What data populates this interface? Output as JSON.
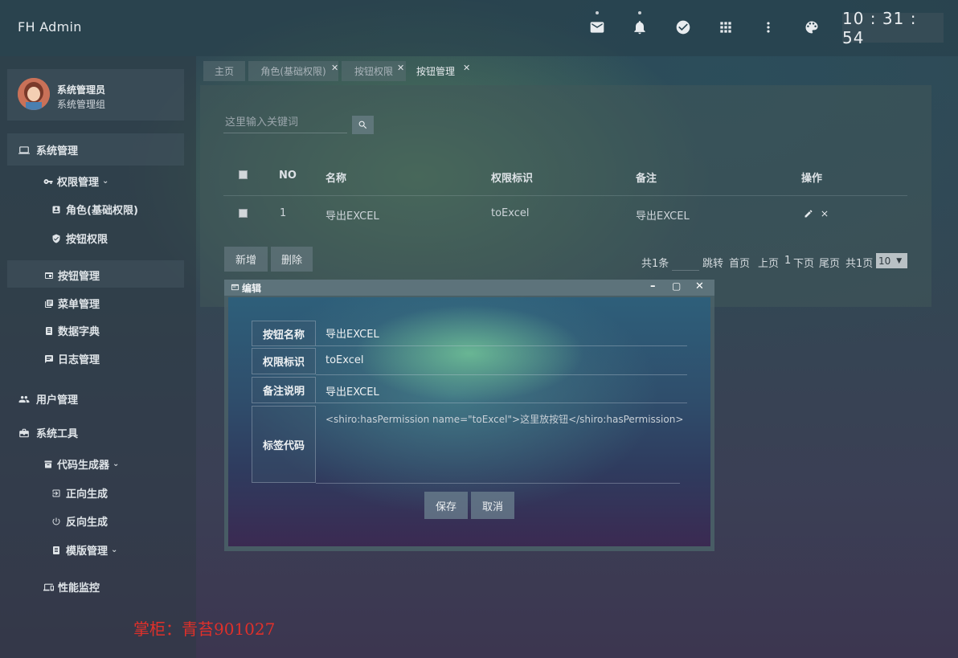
{
  "header": {
    "brand": "FH Admin",
    "clock": "10 : 31 : 54",
    "icons": [
      "mail-icon",
      "bell-icon",
      "check-circle-icon",
      "apps-grid-icon",
      "more-vert-icon",
      "palette-icon"
    ]
  },
  "user": {
    "name": "系统管理员",
    "group": "系统管理组"
  },
  "sidebar": {
    "system_mgmt": "系统管理",
    "perm_mgmt": "权限管理",
    "role": "角色(基础权限)",
    "button_perm": "按钮权限",
    "button_mgmt": "按钮管理",
    "menu_mgmt": "菜单管理",
    "dict": "数据字典",
    "log": "日志管理",
    "user_mgmt": "用户管理",
    "sys_tools": "系统工具",
    "codegen": "代码生成器",
    "forward": "正向生成",
    "reverse": "反向生成",
    "template": "模版管理",
    "monitor": "性能监控"
  },
  "tabs": [
    {
      "label": "主页"
    },
    {
      "label": "角色(基础权限)"
    },
    {
      "label": "按钮权限"
    },
    {
      "label": "按钮管理"
    }
  ],
  "search": {
    "placeholder": "这里输入关键词"
  },
  "table": {
    "headers": [
      "NO",
      "名称",
      "权限标识",
      "备注",
      "操作"
    ],
    "rows": [
      {
        "no": "1",
        "name": "导出EXCEL",
        "perm": "toExcel",
        "remark": "导出EXCEL"
      }
    ]
  },
  "actions": {
    "add": "新增",
    "delete": "删除"
  },
  "pagination": {
    "total": "共1条",
    "jump": "跳转",
    "first": "首页",
    "prev": "上页",
    "current": "1",
    "next": "下页",
    "last": "尾页",
    "pages": "共1页",
    "size": "10"
  },
  "dialog": {
    "title": "编辑",
    "fields": [
      {
        "label": "按钮名称",
        "value": "导出EXCEL"
      },
      {
        "label": "权限标识",
        "value": "toExcel"
      },
      {
        "label": "备注说明",
        "value": "导出EXCEL"
      },
      {
        "label": "标签代码",
        "value": "<shiro:hasPermission name=\"toExcel\">这里放按钮</shiro:hasPermission>"
      }
    ],
    "save": "保存",
    "cancel": "取消"
  },
  "watermark": "掌柜：青苔901027"
}
